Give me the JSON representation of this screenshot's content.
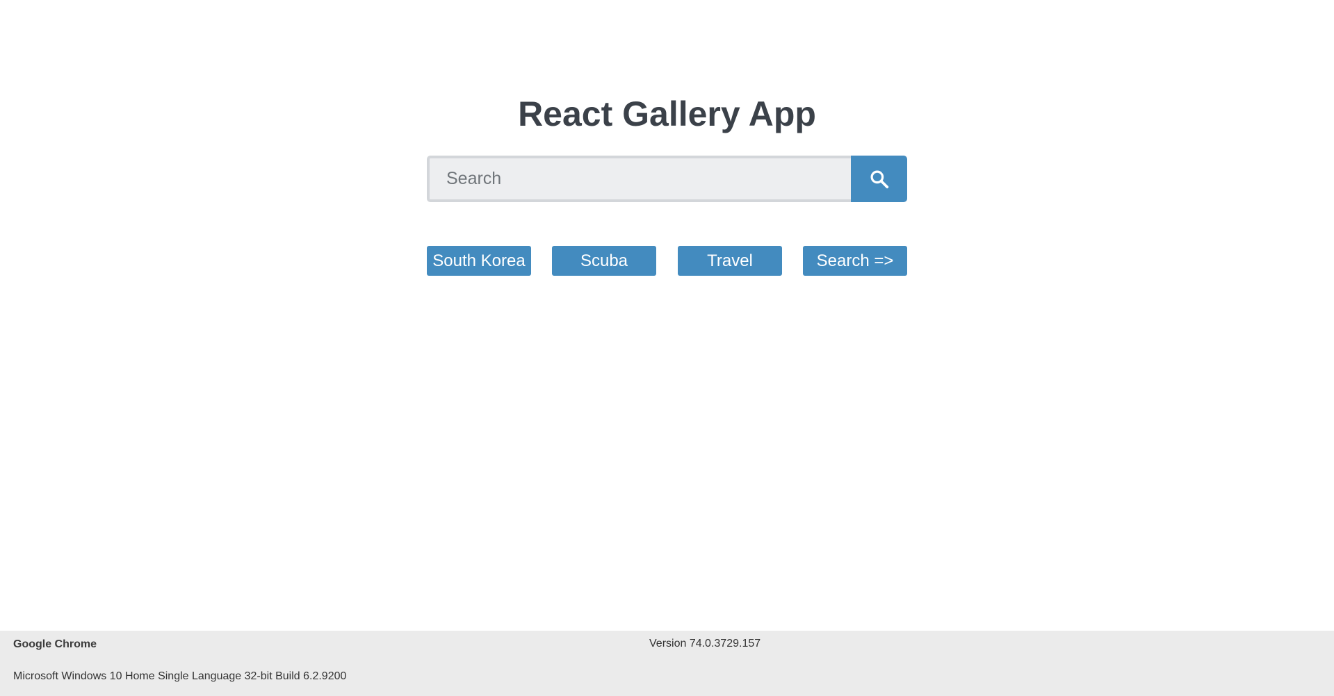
{
  "app": {
    "title": "React Gallery App",
    "search": {
      "placeholder": "Search",
      "value": "",
      "button_icon": "search-icon"
    },
    "nav": [
      {
        "label": "South Korea"
      },
      {
        "label": "Scuba"
      },
      {
        "label": "Travel"
      },
      {
        "label": "Search =>"
      }
    ]
  },
  "footer": {
    "browser_name": "Google Chrome",
    "version": "Version 74.0.3729.157",
    "os": "Microsoft Windows 10 Home Single Language 32-bit Build 6.2.9200"
  },
  "colors": {
    "accent": "#438bbf",
    "title": "#3b4149",
    "input_bg": "#edeef0",
    "footer_bg": "#ebebeb"
  }
}
